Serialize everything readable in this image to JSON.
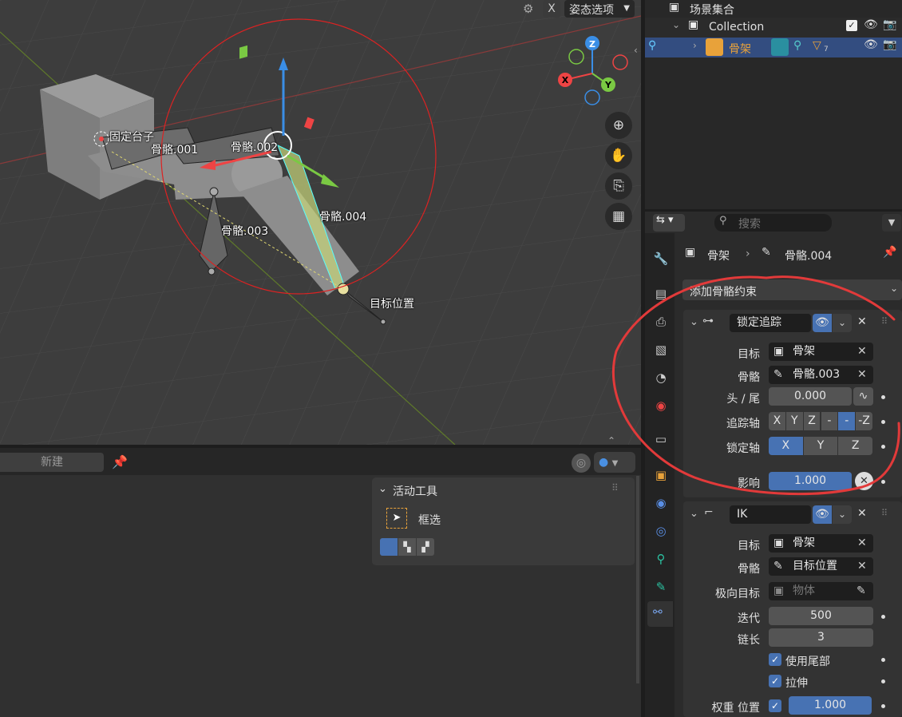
{
  "viewport": {
    "mode_label": "姿态选项",
    "x_label": "X",
    "labels": {
      "fixed_base": "固定台子",
      "bone001": "骨骼.001",
      "bone002": "骨骼.002",
      "bone003": "骨骼.003",
      "bone004": "骨骼.004",
      "target": "目标位置"
    }
  },
  "bottom": {
    "new_label": "新建",
    "active_tool_title": "活动工具",
    "tool_name": "框选"
  },
  "outliner": {
    "scene_collection": "场景集合",
    "collection": "Collection",
    "armature": "骨架",
    "count": "7"
  },
  "properties": {
    "search_placeholder": "搜索",
    "breadcrumb_object": "骨架",
    "breadcrumb_bone": "骨骼.004",
    "add_constraint": "添加骨骼约束",
    "locked_track": {
      "name": "锁定追踪",
      "target_label": "目标",
      "target_value": "骨架",
      "bone_label": "骨骼",
      "bone_value": "骨骼.003",
      "headtail_label": "头 / 尾",
      "headtail_value": "0.000",
      "track_label": "追踪轴",
      "track_axes": [
        "X",
        "Y",
        "Z",
        "-",
        "-",
        "-Z"
      ],
      "lock_label": "锁定轴",
      "lock_axes": [
        "X",
        "Y",
        "Z"
      ],
      "influence_label": "影响",
      "influence_value": "1.000"
    },
    "ik": {
      "name": "IK",
      "target_label": "目标",
      "target_value": "骨架",
      "bone_label": "骨骼",
      "bone_value": "目标位置",
      "pole_label": "极向目标",
      "pole_placeholder": "物体",
      "iter_label": "迭代",
      "iter_value": "500",
      "chain_label": "链长",
      "chain_value": "3",
      "use_tail_label": "使用尾部",
      "stretch_label": "拉伸",
      "weight_label": "权重 位置",
      "weight_value": "1.000"
    }
  },
  "colors": {
    "accent": "#4772b3",
    "annotation": "#e23a3a",
    "bone_selected": "#c8d67a"
  }
}
